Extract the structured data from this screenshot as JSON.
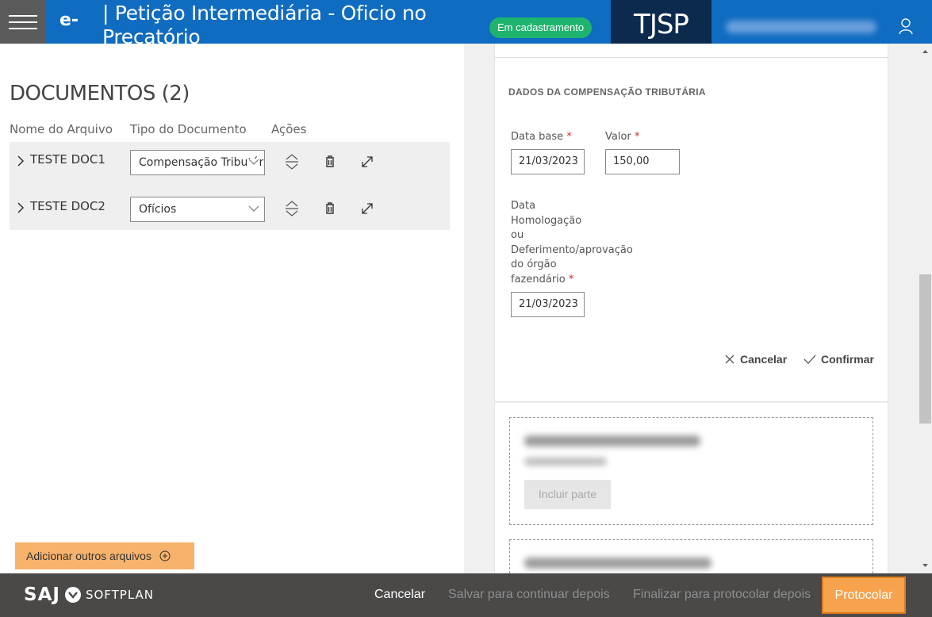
{
  "header": {
    "app_logo": "e-SAJ",
    "title": "| Petição Intermediária - Oficio no Precatório",
    "status_badge": "Em cadastramento",
    "court": "TJSP",
    "colors": {
      "bar": "#0f6cc0",
      "court_bg": "#0b2a4e",
      "status": "#1eb46e"
    }
  },
  "documents": {
    "title": "DOCUMENTOS (2)",
    "columns": [
      "Nome do Arquivo",
      "Tipo do Documento",
      "Ações"
    ],
    "rows": [
      {
        "name": "TESTE DOC1",
        "type": "Compensação Tributária",
        "actions": [
          "move-icon",
          "trash-icon",
          "expand-icon"
        ]
      },
      {
        "name": "TESTE DOC2",
        "type": "Ofícios",
        "actions": [
          "move-icon",
          "trash-icon",
          "expand-icon"
        ]
      }
    ],
    "add_button": "Adicionar outros arquivos"
  },
  "compensation": {
    "section_title": "DADOS DA COMPENSAÇÃO TRIBUTÁRIA",
    "data_base": {
      "label": "Data base",
      "value": "21/03/2023"
    },
    "valor": {
      "label": "Valor",
      "value": "150,00"
    },
    "homologacao": {
      "label_lines": [
        "Data",
        "Homologação",
        "ou",
        "Deferimento/aprovação",
        "do órgão",
        "fazendário"
      ],
      "value": "21/03/2023"
    },
    "required_mark": "*",
    "cancel": "Cancelar",
    "confirm": "Confirmar"
  },
  "parties": {
    "include_button": "Incluir parte"
  },
  "footer": {
    "logo_saj": "SAJ",
    "logo_softplan": "SOFTPLAN",
    "cancel": "Cancelar",
    "save_later": "Salvar para continuar depois",
    "finalize": "Finalizar para protocolar depois",
    "protocolar": "Protocolar",
    "colors": {
      "primary": "#f7a24c"
    }
  }
}
